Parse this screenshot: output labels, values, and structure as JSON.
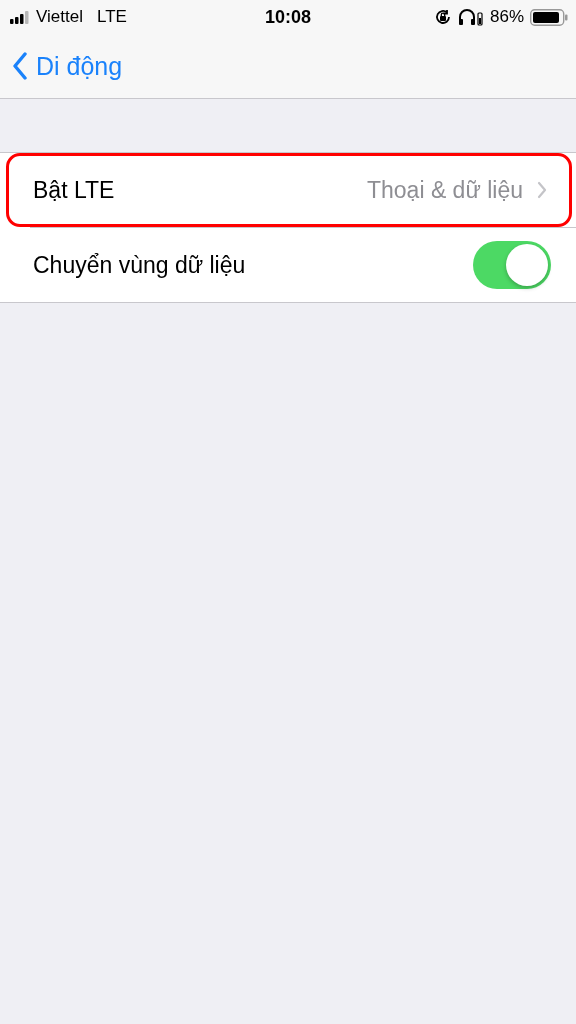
{
  "status_bar": {
    "carrier": "Viettel",
    "network": "LTE",
    "time": "10:08",
    "battery_percent": "86%"
  },
  "nav": {
    "back_label": "Di động"
  },
  "rows": [
    {
      "kind": "disclosure",
      "label": "Bật LTE",
      "value": "Thoại & dữ liệu",
      "highlighted": true
    },
    {
      "kind": "toggle",
      "label": "Chuyển vùng dữ liệu",
      "on": true,
      "highlighted": false
    }
  ]
}
